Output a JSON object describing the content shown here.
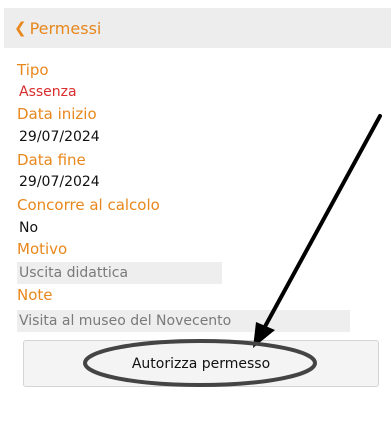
{
  "header": {
    "back_icon": "chevron-left-icon",
    "title": "Permessi",
    "accent_color": "#e8871c"
  },
  "details": {
    "tipo_label": "Tipo",
    "tipo_value": "Assenza",
    "data_inizio_label": "Data inizio",
    "data_inizio_value": "29/07/2024",
    "data_fine_label": "Data fine",
    "data_fine_value": "29/07/2024",
    "concorre_label": "Concorre al calcolo",
    "concorre_value": "No",
    "motivo_label": "Motivo",
    "motivo_value": "Uscita didattica",
    "note_label": "Note",
    "note_value": "Visita al museo del Novecento"
  },
  "actions": {
    "authorize_label": "Autorizza permesso"
  },
  "colors": {
    "label": "#e8871c",
    "value_alert": "#d92c2c",
    "field_background": "#eeeeee"
  }
}
